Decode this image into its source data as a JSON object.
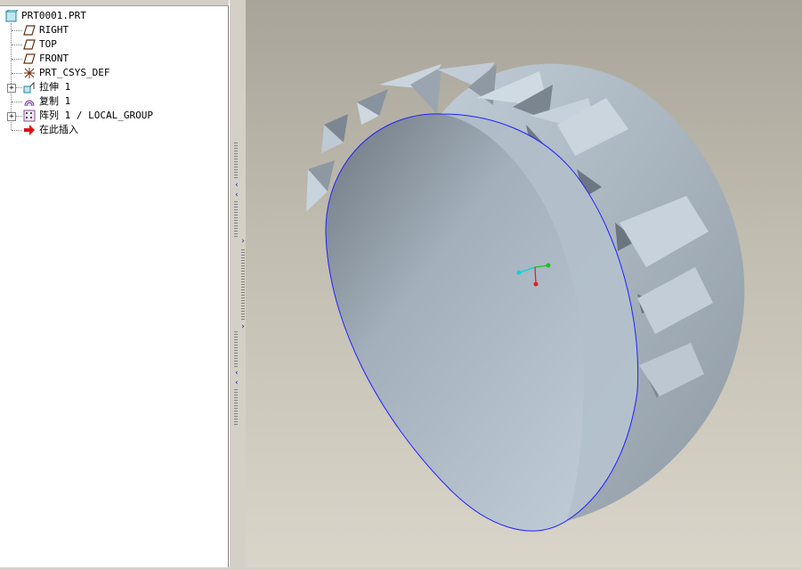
{
  "model_tree": {
    "root": {
      "label": "PRT0001.PRT",
      "icon": "part-icon"
    },
    "items": [
      {
        "label": "RIGHT",
        "icon": "datum-plane-icon"
      },
      {
        "label": "TOP",
        "icon": "datum-plane-icon"
      },
      {
        "label": "FRONT",
        "icon": "datum-plane-icon"
      },
      {
        "label": "PRT_CSYS_DEF",
        "icon": "coordinate-system-icon"
      },
      {
        "label": "拉伸 1",
        "icon": "extrude-icon",
        "expandable": true
      },
      {
        "label": "复制 1",
        "icon": "copy-feature-icon"
      },
      {
        "label": "阵列 1 / LOCAL_GROUP",
        "icon": "pattern-icon",
        "expandable": true
      },
      {
        "label": "在此插入",
        "icon": "insert-here-arrow-icon"
      }
    ]
  },
  "viewport": {
    "model": "ring-with-triangular-teeth",
    "colors": {
      "background_top": "#a8a49a",
      "background_bottom": "#d9d5ca",
      "edge": "#2020ff",
      "surface": "#b8c6d2"
    },
    "csys_colors": {
      "x": "#00d8d8",
      "y": "#20c020",
      "z": "#e02020"
    }
  },
  "sash": {
    "collapse_arrow": "‹",
    "expand_arrow": "›"
  }
}
